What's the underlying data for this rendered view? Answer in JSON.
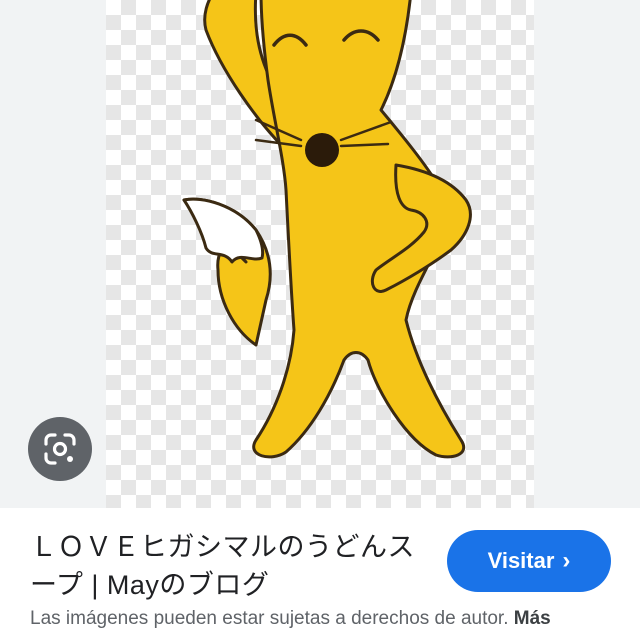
{
  "image": {
    "subject_icon": "yellow-fox-cartoon",
    "background": "transparent-checkerboard"
  },
  "lens_button": {
    "icon": "google-lens-icon"
  },
  "result": {
    "title": "ＬＯＶＥヒガシマルのうどんスープ | Mayのブログ",
    "visit_label": "Visitar",
    "visit_icon": "chevron-right-icon",
    "copyright_notice": "Las imágenes pueden estar sujetas a derechos de autor.",
    "more_label": "Más"
  },
  "colors": {
    "accent": "#1a73e8",
    "fox_yellow": "#f5c518",
    "outline": "#3b2a12"
  }
}
